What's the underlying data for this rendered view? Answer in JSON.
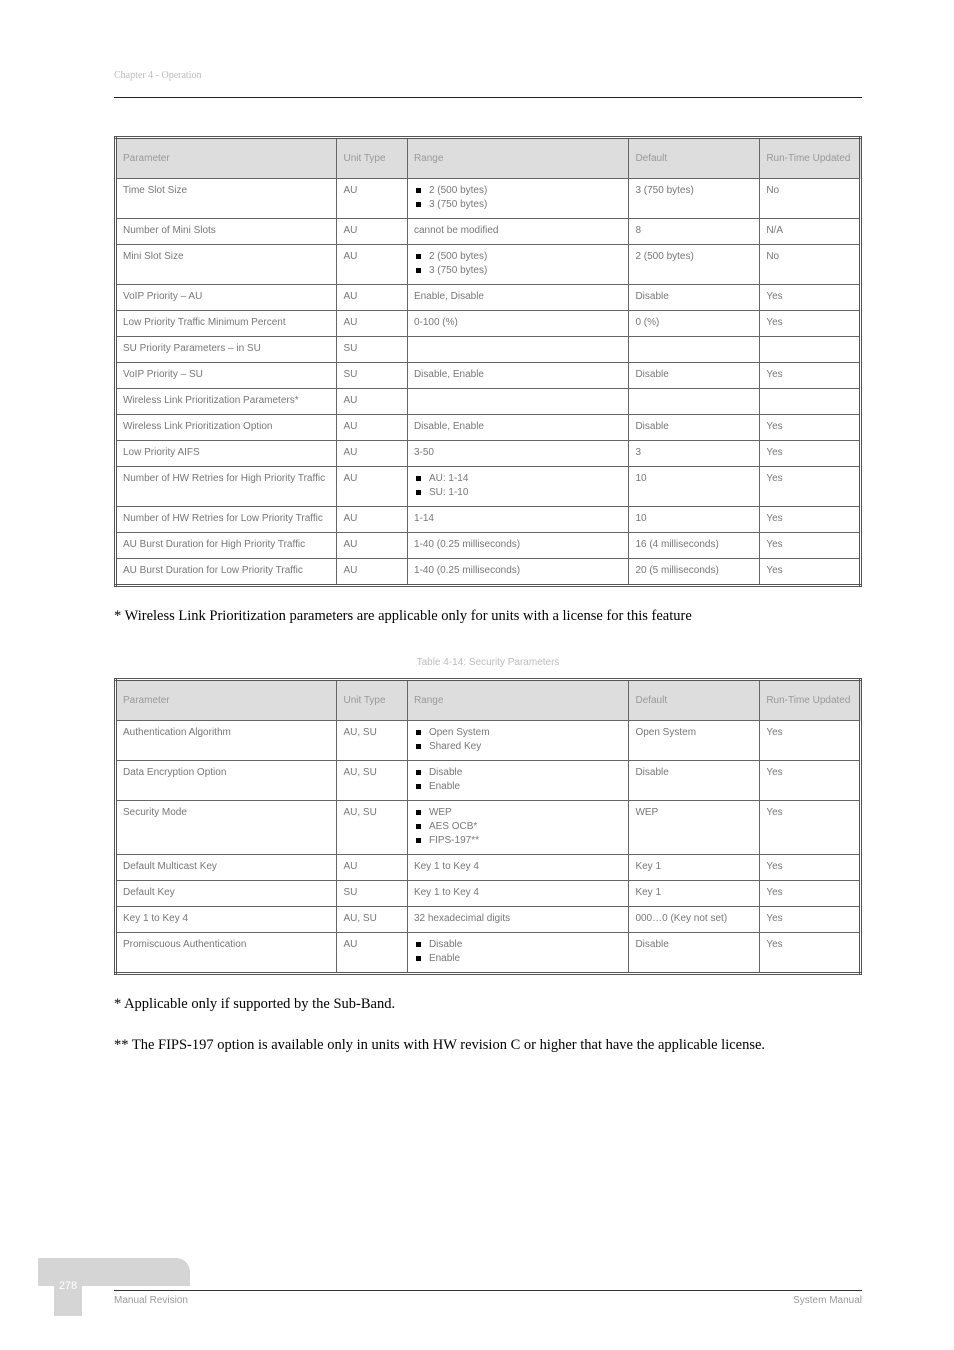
{
  "header": {
    "section_title": "Chapter 4 - Operation"
  },
  "table1": {
    "columns": [
      "Parameter",
      "Unit Type",
      "Range",
      "Default",
      "Run-Time Updated"
    ],
    "rows": [
      {
        "param": "Time Slot Size",
        "unit": "AU",
        "range": [
          {
            "txt": "2 (500 bytes)"
          },
          {
            "txt": "3 (750 bytes)"
          }
        ],
        "default": "3 (750 bytes)",
        "runtime": "No"
      },
      {
        "param": "Number of Mini Slots",
        "unit": "AU",
        "range_plain": "cannot be modified",
        "default": "8",
        "runtime": "N/A"
      },
      {
        "param": "Mini Slot Size",
        "unit": "AU",
        "range": [
          {
            "txt": "2 (500 bytes)"
          },
          {
            "txt": "3 (750 bytes)"
          }
        ],
        "default": "2 (500 bytes)",
        "runtime": "No"
      },
      {
        "param": "VoIP Priority – AU",
        "unit": "AU",
        "range_plain": "Enable, Disable",
        "default": "Disable",
        "runtime": "Yes"
      },
      {
        "param": "Low Priority Traffic Minimum Percent",
        "unit": "AU",
        "range_plain": "0-100 (%)",
        "default": "0 (%)",
        "runtime": "Yes"
      },
      {
        "param": "SU Priority Parameters – in SU",
        "unit": "SU",
        "range_plain": "",
        "default": "",
        "runtime": ""
      },
      {
        "param": "VoIP Priority – SU",
        "unit": "SU",
        "range_plain": "Disable, Enable",
        "default": "Disable",
        "runtime": "Yes"
      },
      {
        "param": "Wireless Link Prioritization Parameters*",
        "unit": "AU",
        "range_plain": "",
        "default": "",
        "runtime": ""
      },
      {
        "param": "Wireless Link Prioritization Option",
        "unit": "AU",
        "range_plain": "Disable, Enable",
        "default": "Disable",
        "runtime": "Yes"
      },
      {
        "param": "Low Priority AIFS",
        "unit": "AU",
        "range_plain": "3-50",
        "default": "3",
        "runtime": "Yes"
      },
      {
        "param": "Number of HW Retries for High Priority Traffic",
        "unit": "AU",
        "range": [
          {
            "txt": "AU: 1-14"
          },
          {
            "txt": "SU: 1-10"
          }
        ],
        "default": "10",
        "runtime": "Yes"
      },
      {
        "param": "Number of HW Retries for Low Priority Traffic",
        "unit": "AU",
        "range_plain": "1-14",
        "default": "10",
        "runtime": "Yes"
      },
      {
        "param": "AU Burst Duration for High Priority Traffic",
        "unit": "AU",
        "range_plain": "1-40 (0.25 milliseconds)",
        "default": "16 (4 milliseconds)",
        "runtime": "Yes"
      },
      {
        "param": "AU Burst Duration for Low Priority Traffic",
        "unit": "AU",
        "range_plain": "1-40 (0.25 milliseconds)",
        "default": "20 (5 milliseconds)",
        "runtime": "Yes"
      }
    ]
  },
  "note1": "* Wireless Link Prioritization parameters are applicable only for units with a license for this feature",
  "table2": {
    "caption": "Table 4-14: Security Parameters",
    "columns": [
      "Parameter",
      "Unit Type",
      "Range",
      "Default",
      "Run-Time Updated"
    ],
    "rows": [
      {
        "param": "Authentication Algorithm",
        "unit": "AU, SU",
        "range": [
          {
            "txt": "Open System"
          },
          {
            "txt": "Shared Key"
          }
        ],
        "default": "Open System",
        "runtime": "Yes"
      },
      {
        "param": "Data Encryption Option",
        "unit": "AU, SU",
        "range": [
          {
            "txt": "Disable"
          },
          {
            "txt": "Enable"
          }
        ],
        "default": "Disable",
        "runtime": "Yes"
      },
      {
        "param": "Security Mode",
        "unit": "AU, SU",
        "range": [
          {
            "txt": "WEP"
          },
          {
            "txt": "AES OCB*"
          },
          {
            "txt": "FIPS-197**"
          }
        ],
        "default": "WEP",
        "runtime": "Yes"
      },
      {
        "param": "Default Multicast Key",
        "unit": "AU",
        "range_plain": "Key 1 to Key 4",
        "default": "Key 1",
        "runtime": "Yes"
      },
      {
        "param": "Default Key",
        "unit": "SU",
        "range_plain": "Key 1 to Key 4",
        "default": "Key 1",
        "runtime": "Yes"
      },
      {
        "param": "Key 1 to Key 4",
        "unit": "AU, SU",
        "range_plain": "32 hexadecimal digits",
        "default": "000…0 (Key not set)",
        "runtime": "Yes"
      },
      {
        "param": "Promiscuous Authentication",
        "unit": "AU",
        "range": [
          {
            "txt": "Disable"
          },
          {
            "txt": "Enable"
          }
        ],
        "default": "Disable",
        "runtime": "Yes"
      }
    ]
  },
  "note2": "* Applicable only if supported by the Sub-Band.",
  "note3": "** The FIPS-197 option is available only in units with HW revision C or higher that have the applicable license.",
  "footer": {
    "pagenum": "278",
    "left": "Manual Revision",
    "right": "System Manual"
  }
}
